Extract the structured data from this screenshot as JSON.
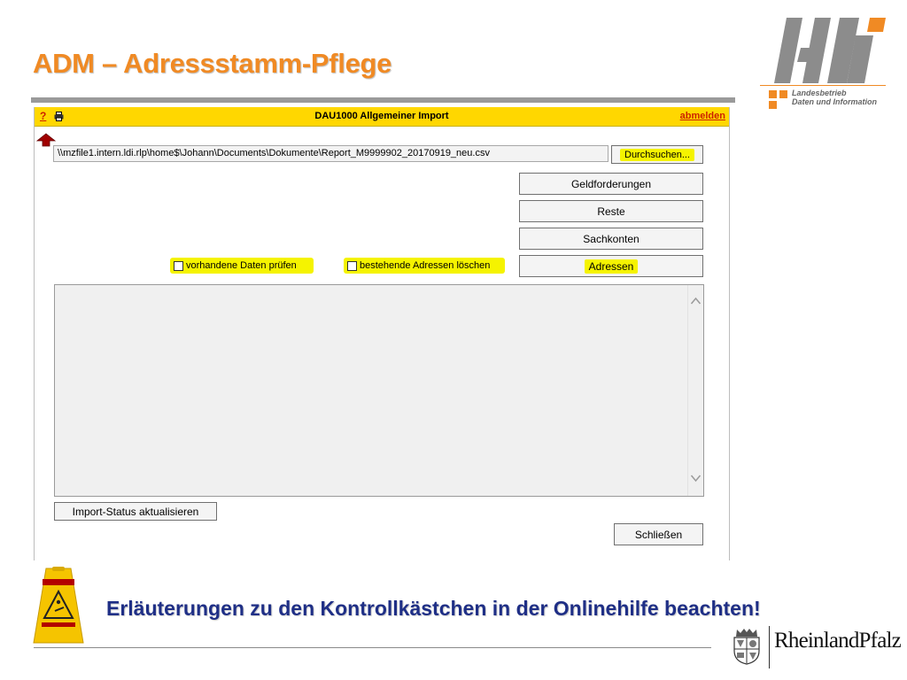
{
  "slide": {
    "title": "ADM – Adressstamm-Pflege",
    "note": "Erläuterungen zu den Kontrollkästchen in der Onlinehilfe beachten!"
  },
  "logo": {
    "brand": "ldi",
    "line1": "Landesbetrieb",
    "line2": "Daten und Information",
    "colors": {
      "gray": "#8c8c8c",
      "orange": "#f08a24"
    }
  },
  "footer_logo": {
    "text": "RheinlandPfalz"
  },
  "app": {
    "help_label": "?",
    "printer_icon": "printer-icon",
    "window_title": "DAU1000 Allgemeiner Import",
    "logout_label": "abmelden",
    "file_path": "\\\\mzfile1.intern.ldi.rlp\\home$\\Johann\\Documents\\Dokumente\\Report_M9999902_20170919_neu.csv",
    "browse_label": "Durchsuchen...",
    "buttons": {
      "geldforderungen": "Geldforderungen",
      "reste": "Reste",
      "sachkonten": "Sachkonten",
      "adressen": "Adressen"
    },
    "checkboxes": {
      "check_existing": {
        "label": "vorhandene Daten prüfen",
        "checked": false
      },
      "delete_addresses": {
        "label": "bestehende Adressen löschen",
        "checked": false
      }
    },
    "import_status_label": "Import-Status aktualisieren",
    "close_label": "Schließen"
  },
  "colors": {
    "title_orange": "#f08a24",
    "titlebar_yellow": "#ffd700",
    "highlight": "#f5f300",
    "note_blue": "#1f2f86",
    "link_red": "#cc2200"
  }
}
